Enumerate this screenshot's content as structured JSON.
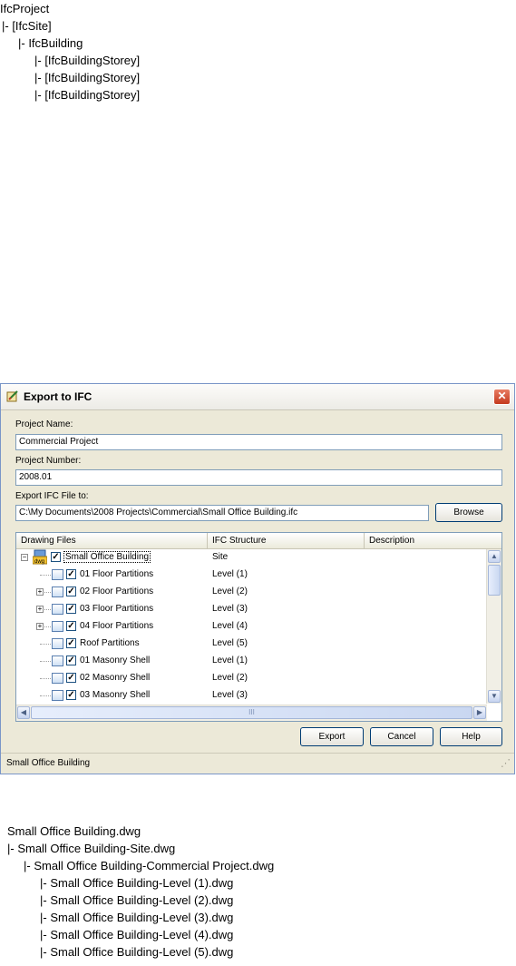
{
  "ifc_tree": {
    "lines": [
      "IfcProject",
      "|-  [IfcSite]",
      "|-  IfcBuilding",
      "|-  [IfcBuildingStorey]",
      "|-  [IfcBuildingStorey]",
      "|-  [IfcBuildingStorey]"
    ]
  },
  "dialog": {
    "title": "Export to IFC",
    "close_glyph": "✕",
    "project_name_label": "Project Name:",
    "project_name_value": "Commercial Project",
    "project_number_label": "Project Number:",
    "project_number_value": "2008.01",
    "export_file_label": "Export IFC File to:",
    "export_file_value": "C:\\My Documents\\2008 Projects\\Commercial\\Small Office Building.ifc",
    "browse_label": "Browse",
    "columns": [
      "Drawing Files",
      "IFC Structure",
      "Description"
    ],
    "rows": [
      {
        "name": "Small Office Building",
        "ifc": "Site"
      },
      {
        "name": "01 Floor Partitions",
        "ifc": "Level (1)"
      },
      {
        "name": "02 Floor Partitions",
        "ifc": "Level (2)"
      },
      {
        "name": "03 Floor Partitions",
        "ifc": "Level (3)"
      },
      {
        "name": "04 Floor Partitions",
        "ifc": "Level (4)"
      },
      {
        "name": "Roof Partitions",
        "ifc": "Level (5)"
      },
      {
        "name": "01 Masonry Shell",
        "ifc": "Level (1)"
      },
      {
        "name": "02 Masonry Shell",
        "ifc": "Level (2)"
      },
      {
        "name": "03 Masonry Shell",
        "ifc": "Level (3)"
      }
    ],
    "check_glyph": "✓",
    "collapse_glyph": "−",
    "expand_glyph": "+",
    "scroll_up_glyph": "▲",
    "scroll_down_glyph": "▼",
    "scroll_left_glyph": "◀",
    "scroll_right_glyph": "▶",
    "hscroll_grip": "III",
    "export_label": "Export",
    "cancel_label": "Cancel",
    "help_label": "Help",
    "status_text": "Small Office Building",
    "grip_glyph": "⋰"
  },
  "dwg_tree": {
    "lines": [
      "Small Office Building.dwg",
      "|-  Small Office Building-Site.dwg",
      "|-  Small Office Building-Commercial Project.dwg",
      "|-  Small Office Building-Level (1).dwg",
      "|-  Small Office Building-Level (2).dwg",
      "|-  Small Office Building-Level (3).dwg",
      "|-  Small Office Building-Level (4).dwg",
      "|-  Small Office Building-Level (5).dwg"
    ]
  }
}
